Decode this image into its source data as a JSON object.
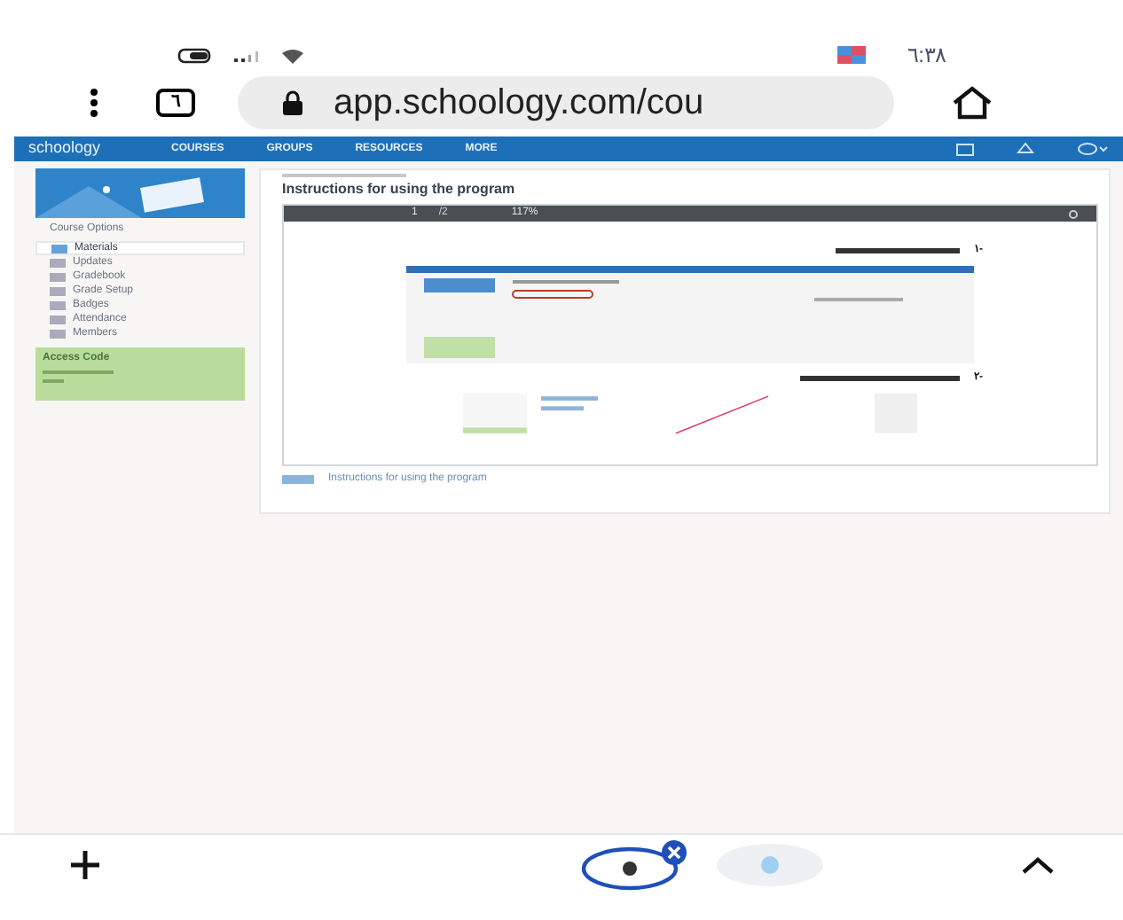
{
  "status_bar": {
    "time": "٦:٣٨"
  },
  "browser": {
    "tab_count": "٦",
    "url": "app.schoology.com/cou"
  },
  "site_nav": {
    "logo": "schoology",
    "items": [
      "COURSES",
      "GROUPS",
      "RESOURCES",
      "MORE"
    ]
  },
  "sidebar": {
    "heading": "Course Options",
    "items": [
      {
        "label": "Materials",
        "selected": true
      },
      {
        "label": "Updates",
        "selected": false
      },
      {
        "label": "Gradebook",
        "selected": false
      },
      {
        "label": "Grade Setup",
        "selected": false
      },
      {
        "label": "Badges",
        "selected": false
      },
      {
        "label": "Attendance",
        "selected": false
      },
      {
        "label": "Members",
        "selected": false
      }
    ],
    "access_code": {
      "title": "Access Code"
    }
  },
  "document": {
    "title": "Instructions for using the program",
    "toolbar": {
      "page": "1",
      "pages": "/2",
      "zoom": "117%"
    },
    "steps": [
      "١-",
      "٢-"
    ],
    "attachment": "Instructions for using the program"
  }
}
